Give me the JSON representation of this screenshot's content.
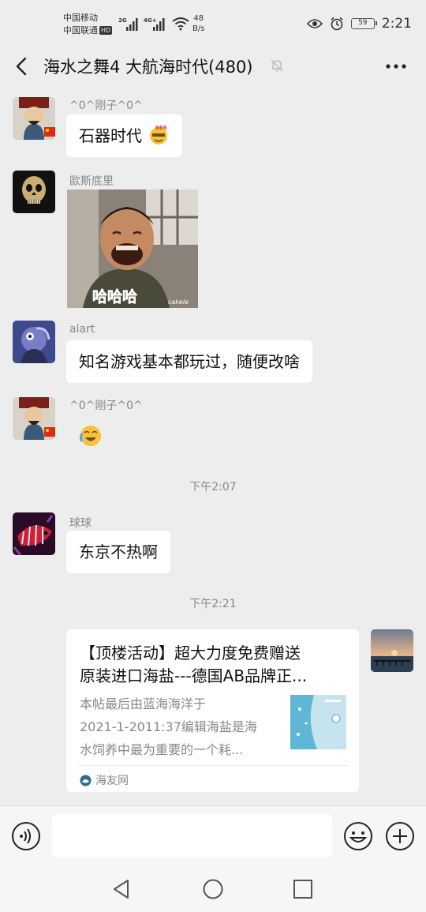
{
  "status": {
    "carrier1": "中国移动",
    "carrier2": "中国联通",
    "hd": "HD",
    "sig1": "2G",
    "sig2": "4G+",
    "net_speed": "48",
    "net_unit": "B/s",
    "battery": "59",
    "time": "2:21"
  },
  "header": {
    "title": "海水之舞4 大航海时代(480)"
  },
  "messages": [
    {
      "sender": "^0^刚子^0^",
      "text": "石器时代"
    },
    {
      "sender": "歐斯底里",
      "image_caption": "哈哈哈",
      "image_watermark": "cakele"
    },
    {
      "sender": "alart",
      "text": "知名游戏基本都玩过，随便改啥"
    },
    {
      "sender": "^0^刚子^0^"
    },
    {
      "sender": "球球",
      "text": "东京不热啊"
    }
  ],
  "timestamps": [
    "下午2:07",
    "下午2:21"
  ],
  "card": {
    "title_line1": "【顶楼活动】超大力度免费赠送",
    "title_line2": "原装进口海盐---德国AB品牌正...",
    "desc_line1": "本帖最后由蓝海海洋于",
    "desc_line2": "2021-1-2011:37编辑海盐是海",
    "desc_line3": "水饲养中最为重要的一个耗...",
    "source": "海友网"
  },
  "colors": {
    "background": "#ededed",
    "bubble": "#ffffff",
    "meta_text": "#888888"
  }
}
